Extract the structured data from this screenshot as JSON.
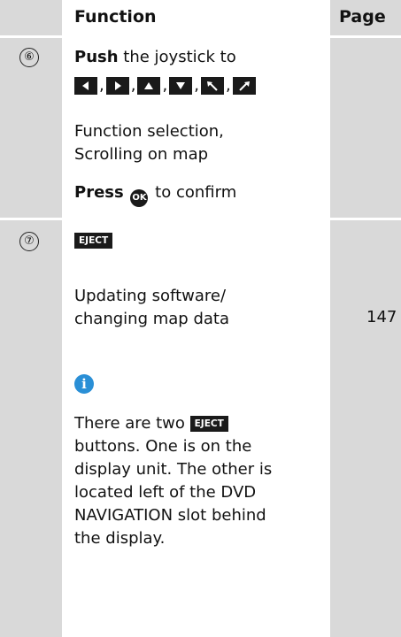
{
  "header": {
    "number": "",
    "function": "Function",
    "page": "Page"
  },
  "row6": {
    "number": "⑥",
    "push_bold": "Push",
    "push_rest": " the joystick to",
    "arrows": [
      "left-arrow-icon",
      "right-arrow-icon",
      "up-arrow-icon",
      "down-arrow-icon",
      "diagonal-up-left-icon",
      "diagonal-up-right-icon"
    ],
    "desc_line1": "Function selection,",
    "desc_line2": "Scrolling on map",
    "press_bold": "Press",
    "ok_label": "OK",
    "press_rest": " to confirm"
  },
  "row7": {
    "number": "⑦",
    "eject_label": "EJECT",
    "update_line1": "Updating software/",
    "update_line2": "changing map data",
    "page": "147",
    "info_icon": "info-icon",
    "info_color": "#2a8fd6",
    "note_line1_pre": "There are two ",
    "note_line2": "buttons. One is on the",
    "note_line3": "display unit. The other is",
    "note_line4": "located left of the DVD",
    "note_line5": "NAVIGATION slot behind",
    "note_line6": "the display."
  },
  "colors": {
    "shade": "#d9d9d9",
    "key": "#1a1a1a"
  }
}
